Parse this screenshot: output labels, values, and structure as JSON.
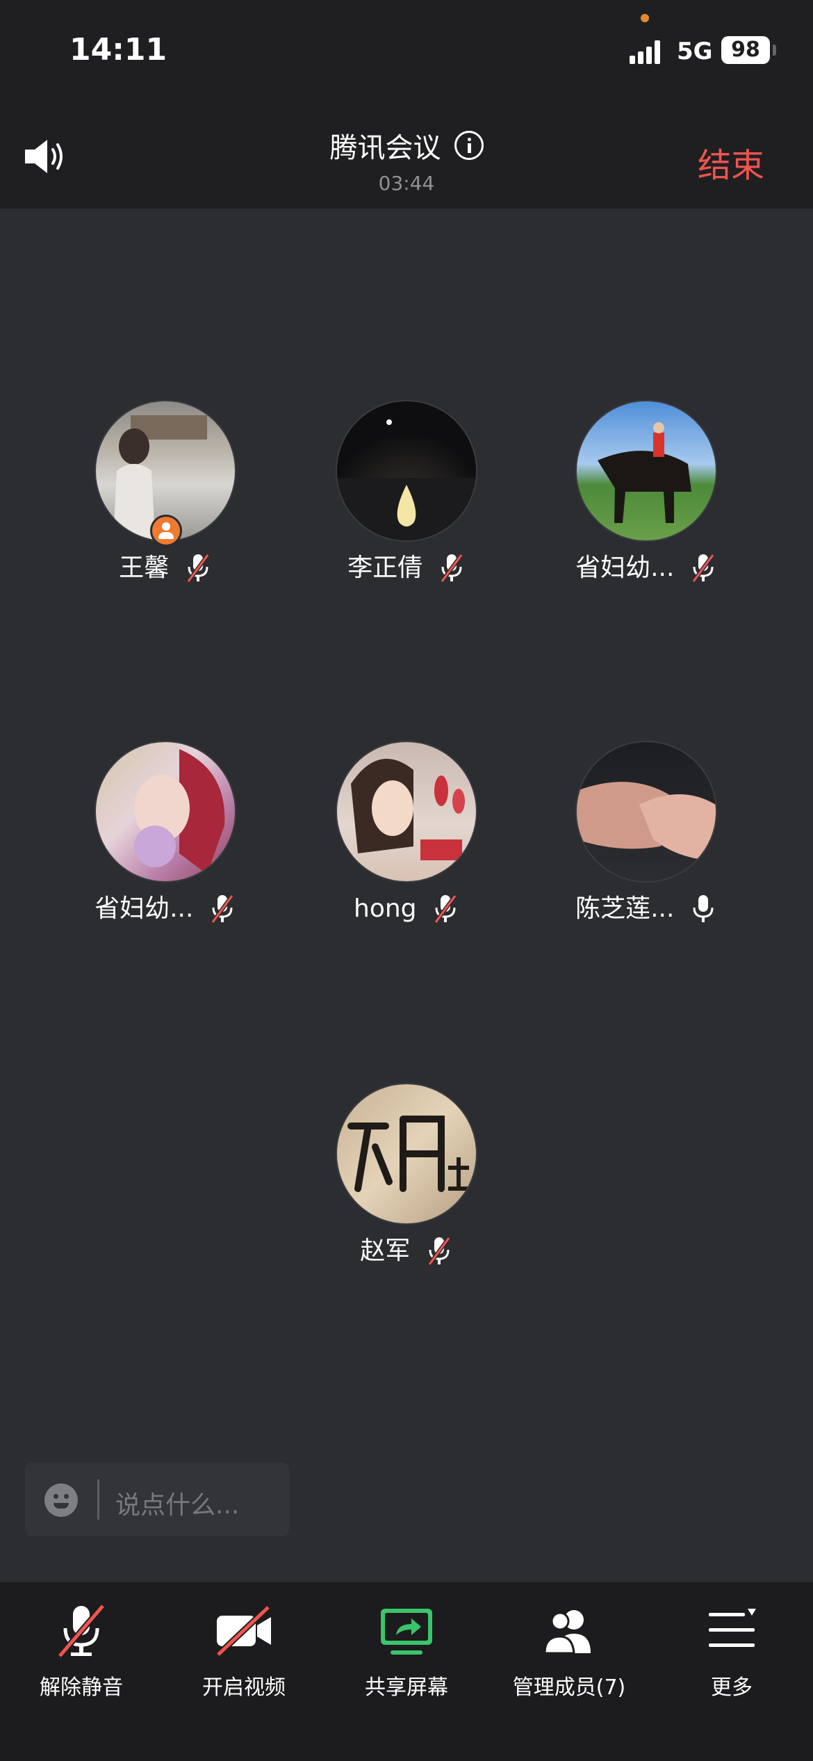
{
  "status_bar": {
    "time": "14:11",
    "network": "5G",
    "battery": "98"
  },
  "header": {
    "title": "腾讯会议",
    "timer": "03:44",
    "end_label": "结束"
  },
  "participants": [
    {
      "name": "王馨",
      "mic": "muted",
      "host": true
    },
    {
      "name": "李正倩",
      "mic": "muted"
    },
    {
      "name": "省妇幼...",
      "mic": "muted"
    },
    {
      "name": "省妇幼...",
      "mic": "muted"
    },
    {
      "name": "hong",
      "mic": "muted"
    },
    {
      "name": "陈芝莲...",
      "mic": "on"
    },
    {
      "name": "赵军",
      "mic": "muted"
    }
  ],
  "chat": {
    "placeholder": "说点什么..."
  },
  "toolbar": {
    "unmute_label": "解除静音",
    "video_label": "开启视频",
    "share_label": "共享屏幕",
    "members_label": "管理成员(7)",
    "more_label": "更多"
  },
  "colors": {
    "accent_red": "#f1544f",
    "share_green": "#3ac56a",
    "host_orange": "#f07a30"
  }
}
